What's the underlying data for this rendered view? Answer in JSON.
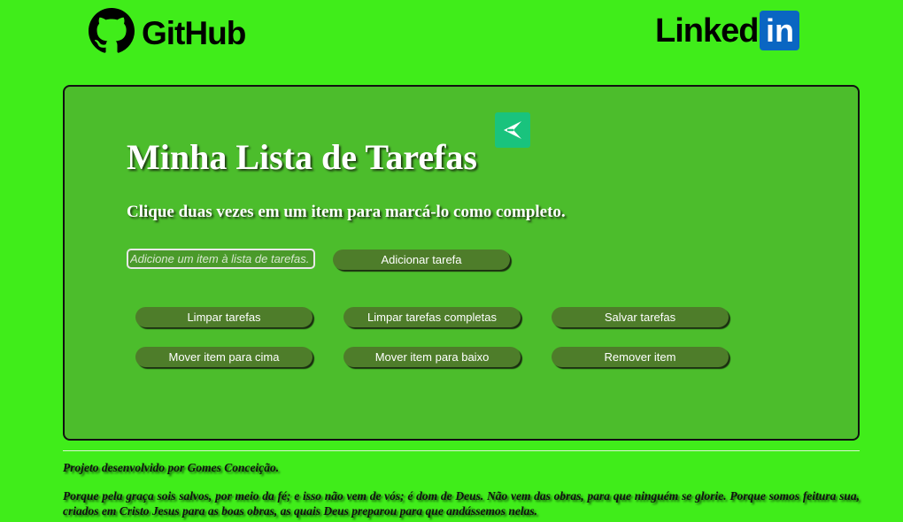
{
  "header": {
    "github_label": "GitHub",
    "github_icon": "github-octocat-icon",
    "linkedin_word": "Linked",
    "linkedin_box": "in",
    "linkedin_color": "#0a66c2"
  },
  "panel": {
    "badge_icon": "paper-plane-icon",
    "badge_color": "#19c37d",
    "title": "Minha Lista de Tarefas",
    "subtitle": "Clique duas vezes em um item para marcá-lo como completo.",
    "input_placeholder": "Adicione um item à lista de tarefas.",
    "add_button": "Adicionar tarefa",
    "buttons": {
      "clear_all": "Limpar tarefas",
      "clear_completed": "Limpar tarefas completas",
      "save": "Salvar tarefas",
      "move_up": "Mover item para cima",
      "move_down": "Mover item para baixo",
      "remove": "Remover item"
    }
  },
  "footer": {
    "credit": "Projeto desenvolvido por Gomes Conceição.",
    "verse": "Porque pela graça sois salvos, por meio da fé; e isso não vem de vós; é dom de Deus. Não vem das obras, para que ninguém se glorie. Porque somos feitura sua, criados em Cristo Jesus para as boas obras, as quais Deus preparou para que andássemos nelas."
  },
  "colors": {
    "page_background": "#40ed1a",
    "panel_background": "#4cbd2c",
    "button_background": "#4e7d2a"
  }
}
